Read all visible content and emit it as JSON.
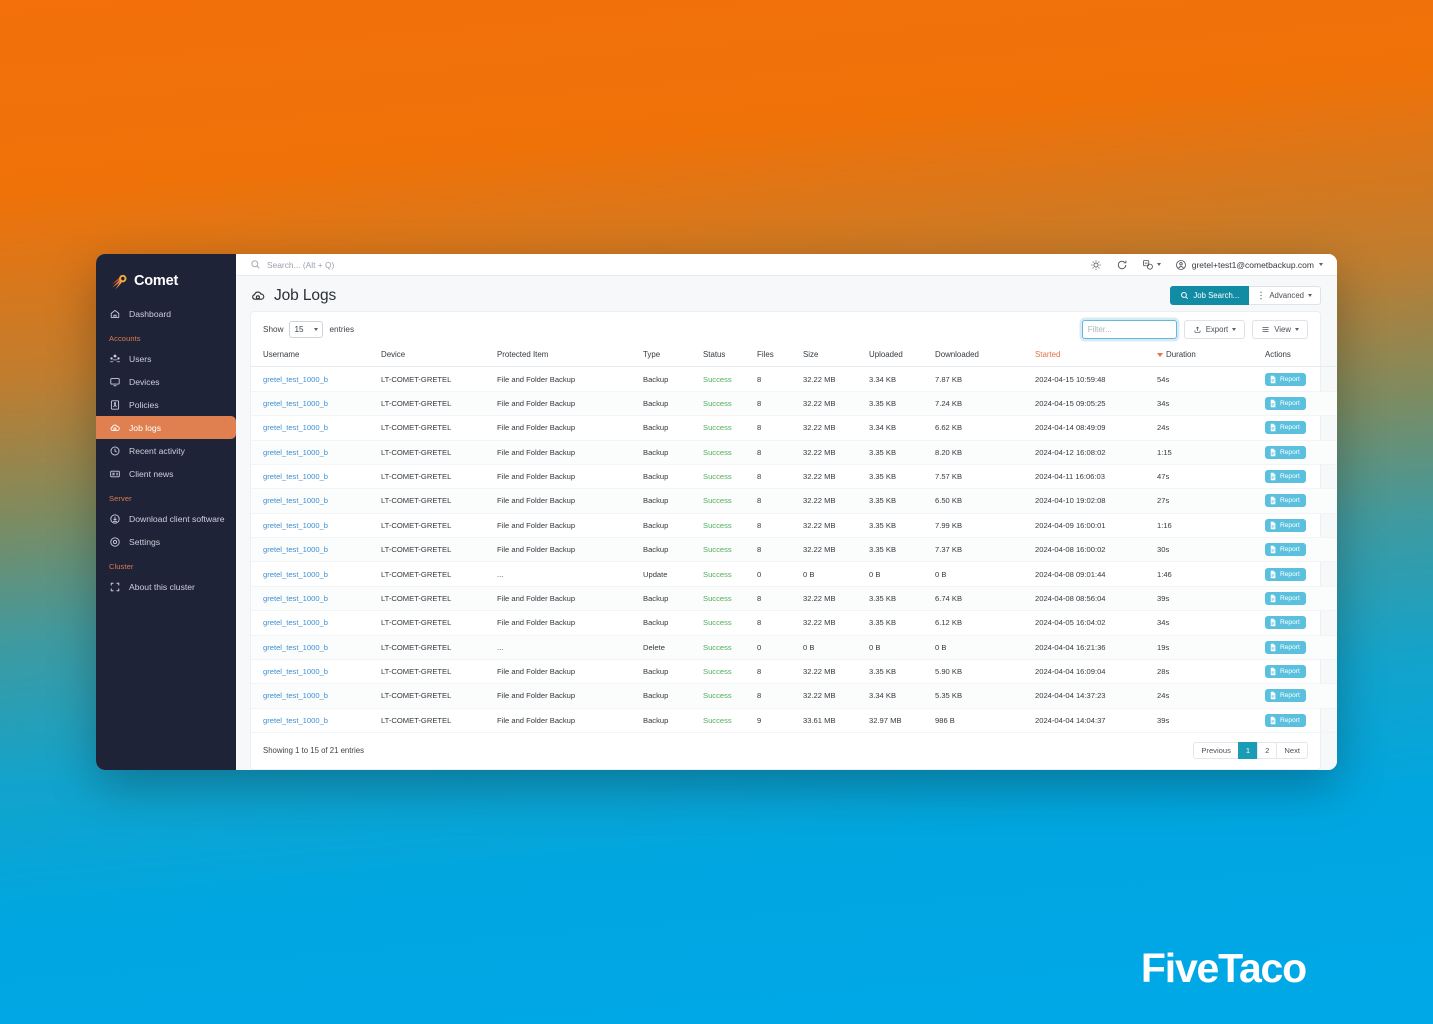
{
  "sidebar": {
    "brand": "Comet",
    "brand_icon": "comet-logo-icon",
    "top_items": [
      {
        "label": "Dashboard",
        "icon": "home-icon",
        "active": false
      }
    ],
    "groups": [
      {
        "label": "Accounts",
        "items": [
          {
            "label": "Users",
            "icon": "users-icon",
            "active": false
          },
          {
            "label": "Devices",
            "icon": "monitor-icon",
            "active": false
          },
          {
            "label": "Policies",
            "icon": "policy-document-icon",
            "active": false
          },
          {
            "label": "Job logs",
            "icon": "cloud-log-icon",
            "active": true
          },
          {
            "label": "Recent activity",
            "icon": "clock-icon",
            "active": false
          },
          {
            "label": "Client news",
            "icon": "news-icon",
            "active": false
          }
        ]
      },
      {
        "label": "Server",
        "items": [
          {
            "label": "Download client software",
            "icon": "download-icon",
            "active": false
          },
          {
            "label": "Settings",
            "icon": "gear-icon",
            "active": false
          }
        ]
      },
      {
        "label": "Cluster",
        "items": [
          {
            "label": "About this cluster",
            "icon": "expand-icon",
            "active": false
          }
        ]
      }
    ]
  },
  "topbar": {
    "search_placeholder": "Search... (Alt + Q)",
    "search_icon": "search-icon",
    "theme_icon": "brightness-icon",
    "refresh_icon": "refresh-icon",
    "language_icon": "language-icon",
    "account_icon": "user-circle-icon",
    "account_email": "gretel+test1@cometbackup.com"
  },
  "page": {
    "title": "Job Logs",
    "title_icon": "cloud-log-icon",
    "job_search_label": "Job Search...",
    "job_search_icon": "search-icon",
    "advanced_label": "Advanced",
    "advanced_icon": "dots-vertical-icon"
  },
  "toolbar": {
    "show_label": "Show",
    "entries_label": "entries",
    "page_size": "15",
    "filter_placeholder": "Filter...",
    "export_label": "Export",
    "export_icon": "upload-icon",
    "view_label": "View",
    "view_icon": "list-icon"
  },
  "table": {
    "columns": [
      "Username",
      "Device",
      "Protected Item",
      "Type",
      "Status",
      "Files",
      "Size",
      "Uploaded",
      "Downloaded",
      "Started",
      "Duration",
      "Actions"
    ],
    "sorted_column": "Started",
    "sort_indicator_column": "Duration",
    "action_label": "Report",
    "action_icon": "document-icon",
    "rows": [
      {
        "username": "gretel_test_1000_b",
        "device": "LT-COMET-GRETEL",
        "item": "File and Folder Backup",
        "type": "Backup",
        "status": "Success",
        "files": "8",
        "size": "32.22 MB",
        "uploaded": "3.34 KB",
        "downloaded": "7.87 KB",
        "started": "2024-04-15 10:59:48",
        "duration": "54s"
      },
      {
        "username": "gretel_test_1000_b",
        "device": "LT-COMET-GRETEL",
        "item": "File and Folder Backup",
        "type": "Backup",
        "status": "Success",
        "files": "8",
        "size": "32.22 MB",
        "uploaded": "3.35 KB",
        "downloaded": "7.24 KB",
        "started": "2024-04-15 09:05:25",
        "duration": "34s"
      },
      {
        "username": "gretel_test_1000_b",
        "device": "LT-COMET-GRETEL",
        "item": "File and Folder Backup",
        "type": "Backup",
        "status": "Success",
        "files": "8",
        "size": "32.22 MB",
        "uploaded": "3.34 KB",
        "downloaded": "6.62 KB",
        "started": "2024-04-14 08:49:09",
        "duration": "24s"
      },
      {
        "username": "gretel_test_1000_b",
        "device": "LT-COMET-GRETEL",
        "item": "File and Folder Backup",
        "type": "Backup",
        "status": "Success",
        "files": "8",
        "size": "32.22 MB",
        "uploaded": "3.35 KB",
        "downloaded": "8.20 KB",
        "started": "2024-04-12 16:08:02",
        "duration": "1:15"
      },
      {
        "username": "gretel_test_1000_b",
        "device": "LT-COMET-GRETEL",
        "item": "File and Folder Backup",
        "type": "Backup",
        "status": "Success",
        "files": "8",
        "size": "32.22 MB",
        "uploaded": "3.35 KB",
        "downloaded": "7.57 KB",
        "started": "2024-04-11 16:06:03",
        "duration": "47s"
      },
      {
        "username": "gretel_test_1000_b",
        "device": "LT-COMET-GRETEL",
        "item": "File and Folder Backup",
        "type": "Backup",
        "status": "Success",
        "files": "8",
        "size": "32.22 MB",
        "uploaded": "3.35 KB",
        "downloaded": "6.50 KB",
        "started": "2024-04-10 19:02:08",
        "duration": "27s"
      },
      {
        "username": "gretel_test_1000_b",
        "device": "LT-COMET-GRETEL",
        "item": "File and Folder Backup",
        "type": "Backup",
        "status": "Success",
        "files": "8",
        "size": "32.22 MB",
        "uploaded": "3.35 KB",
        "downloaded": "7.99 KB",
        "started": "2024-04-09 16:00:01",
        "duration": "1:16"
      },
      {
        "username": "gretel_test_1000_b",
        "device": "LT-COMET-GRETEL",
        "item": "File and Folder Backup",
        "type": "Backup",
        "status": "Success",
        "files": "8",
        "size": "32.22 MB",
        "uploaded": "3.35 KB",
        "downloaded": "7.37 KB",
        "started": "2024-04-08 16:00:02",
        "duration": "30s"
      },
      {
        "username": "gretel_test_1000_b",
        "device": "LT-COMET-GRETEL",
        "item": "...",
        "type": "Update",
        "status": "Success",
        "files": "0",
        "size": "0 B",
        "uploaded": "0 B",
        "downloaded": "0 B",
        "started": "2024-04-08 09:01:44",
        "duration": "1:46"
      },
      {
        "username": "gretel_test_1000_b",
        "device": "LT-COMET-GRETEL",
        "item": "File and Folder Backup",
        "type": "Backup",
        "status": "Success",
        "files": "8",
        "size": "32.22 MB",
        "uploaded": "3.35 KB",
        "downloaded": "6.74 KB",
        "started": "2024-04-08 08:56:04",
        "duration": "39s"
      },
      {
        "username": "gretel_test_1000_b",
        "device": "LT-COMET-GRETEL",
        "item": "File and Folder Backup",
        "type": "Backup",
        "status": "Success",
        "files": "8",
        "size": "32.22 MB",
        "uploaded": "3.35 KB",
        "downloaded": "6.12 KB",
        "started": "2024-04-05 16:04:02",
        "duration": "34s"
      },
      {
        "username": "gretel_test_1000_b",
        "device": "LT-COMET-GRETEL",
        "item": "...",
        "type": "Delete",
        "status": "Success",
        "files": "0",
        "size": "0 B",
        "uploaded": "0 B",
        "downloaded": "0 B",
        "started": "2024-04-04 16:21:36",
        "duration": "19s"
      },
      {
        "username": "gretel_test_1000_b",
        "device": "LT-COMET-GRETEL",
        "item": "File and Folder Backup",
        "type": "Backup",
        "status": "Success",
        "files": "8",
        "size": "32.22 MB",
        "uploaded": "3.35 KB",
        "downloaded": "5.90 KB",
        "started": "2024-04-04 16:09:04",
        "duration": "28s"
      },
      {
        "username": "gretel_test_1000_b",
        "device": "LT-COMET-GRETEL",
        "item": "File and Folder Backup",
        "type": "Backup",
        "status": "Success",
        "files": "8",
        "size": "32.22 MB",
        "uploaded": "3.34 KB",
        "downloaded": "5.35 KB",
        "started": "2024-04-04 14:37:23",
        "duration": "24s"
      },
      {
        "username": "gretel_test_1000_b",
        "device": "LT-COMET-GRETEL",
        "item": "File and Folder Backup",
        "type": "Backup",
        "status": "Success",
        "files": "9",
        "size": "33.61 MB",
        "uploaded": "32.97 MB",
        "downloaded": "986 B",
        "started": "2024-04-04 14:04:37",
        "duration": "39s"
      }
    ]
  },
  "footer": {
    "showing": "Showing 1 to 15 of 21 entries",
    "previous_label": "Previous",
    "next_label": "Next",
    "pages": [
      "1",
      "2"
    ],
    "current_page": "1"
  },
  "watermark": {
    "text": "FiveTaco"
  },
  "colors": {
    "sidebar_bg": "#1f2337",
    "active_nav": "#e08050",
    "accent_teal": "#118ca4",
    "link_blue": "#3d8fd1",
    "success_green": "#4fae5c",
    "report_blue": "#5bc0de",
    "sorted_header": "#e2714a"
  }
}
